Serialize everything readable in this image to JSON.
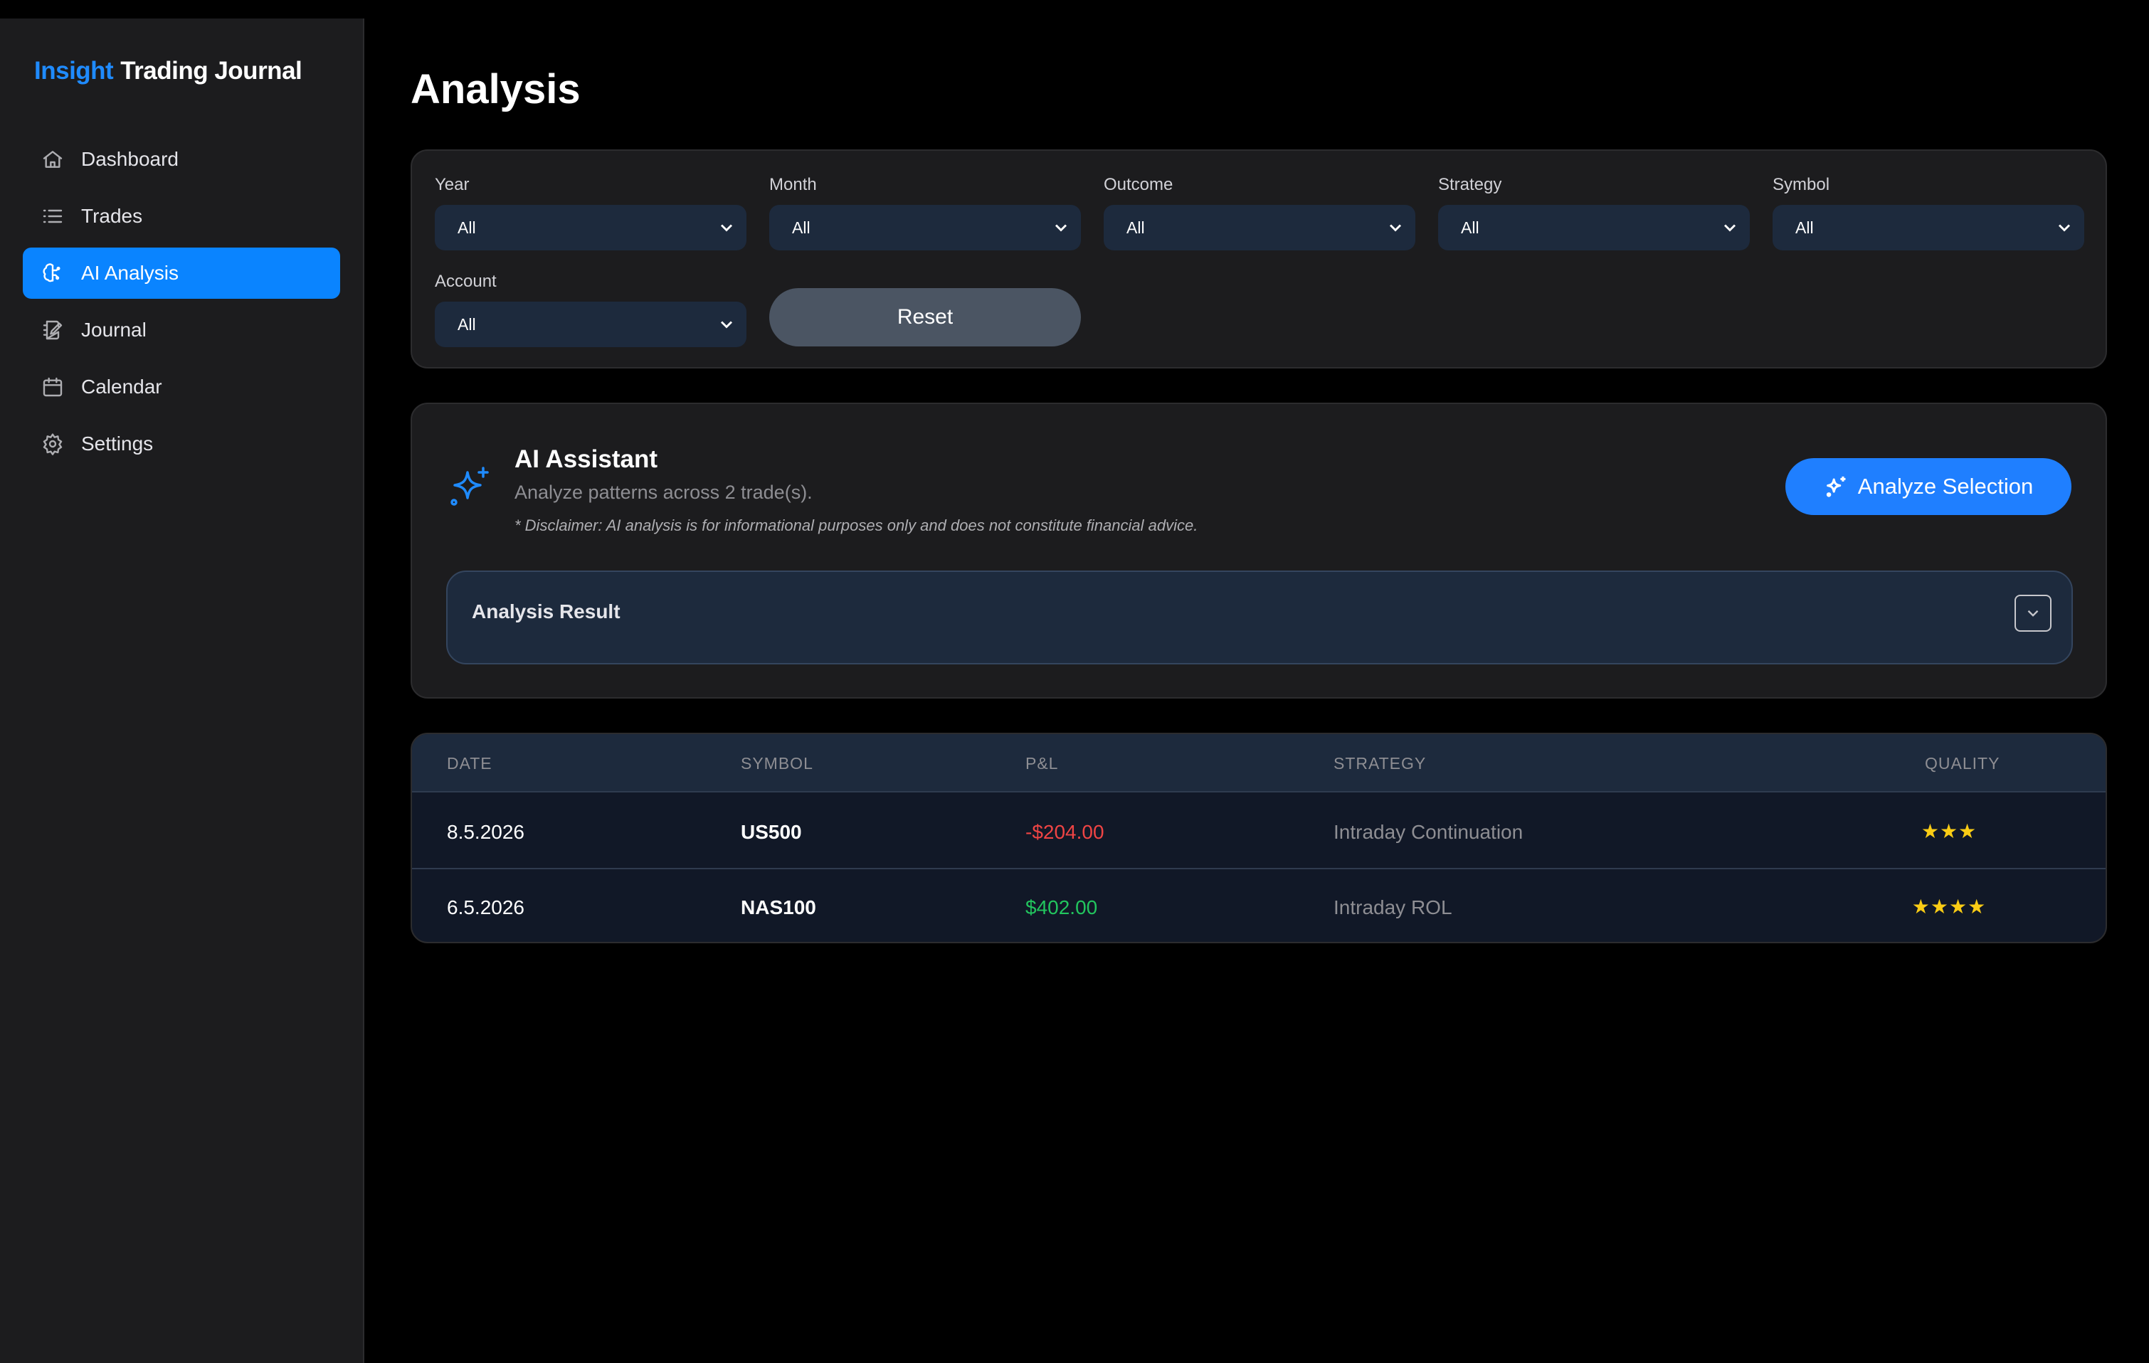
{
  "brand": {
    "accent": "Insight",
    "rest": "Trading Journal"
  },
  "nav": {
    "items": [
      {
        "label": "Dashboard",
        "icon": "home-icon"
      },
      {
        "label": "Trades",
        "icon": "list-icon"
      },
      {
        "label": "AI Analysis",
        "icon": "brain-icon",
        "active": true
      },
      {
        "label": "Journal",
        "icon": "notebook-icon"
      },
      {
        "label": "Calendar",
        "icon": "calendar-icon"
      },
      {
        "label": "Settings",
        "icon": "gear-icon"
      }
    ]
  },
  "page": {
    "title": "Analysis"
  },
  "filters": {
    "year": {
      "label": "Year",
      "value": "All"
    },
    "month": {
      "label": "Month",
      "value": "All"
    },
    "outcome": {
      "label": "Outcome",
      "value": "All"
    },
    "strategy": {
      "label": "Strategy",
      "value": "All"
    },
    "symbol": {
      "label": "Symbol",
      "value": "All"
    },
    "account": {
      "label": "Account",
      "value": "All"
    },
    "reset_label": "Reset"
  },
  "assistant": {
    "title": "AI Assistant",
    "subtitle": "Analyze patterns across 2 trade(s).",
    "disclaimer": "* Disclaimer: AI analysis is for informational purposes only and does not constitute financial advice.",
    "analyze_label": "Analyze Selection",
    "result_title": "Analysis Result"
  },
  "table": {
    "headers": {
      "date": "DATE",
      "symbol": "SYMBOL",
      "pnl": "P&L",
      "strategy": "STRATEGY",
      "quality": "QUALITY"
    },
    "rows": [
      {
        "date": "8.5.2026",
        "symbol": "US500",
        "pnl": "-$204.00",
        "strategy": "Intraday Continuation",
        "quality": "★★★",
        "quality_stars": 3
      },
      {
        "date": "6.5.2026",
        "symbol": "NAS100",
        "pnl": "$402.00",
        "strategy": "Intraday ROL",
        "quality": "★★★★",
        "quality_stars": 4
      }
    ]
  },
  "colors": {
    "accent": "#0a84ff",
    "brand_accent": "#1f8bff",
    "loss": "#ef4444",
    "profit": "#22c55e",
    "star": "#facc15"
  }
}
